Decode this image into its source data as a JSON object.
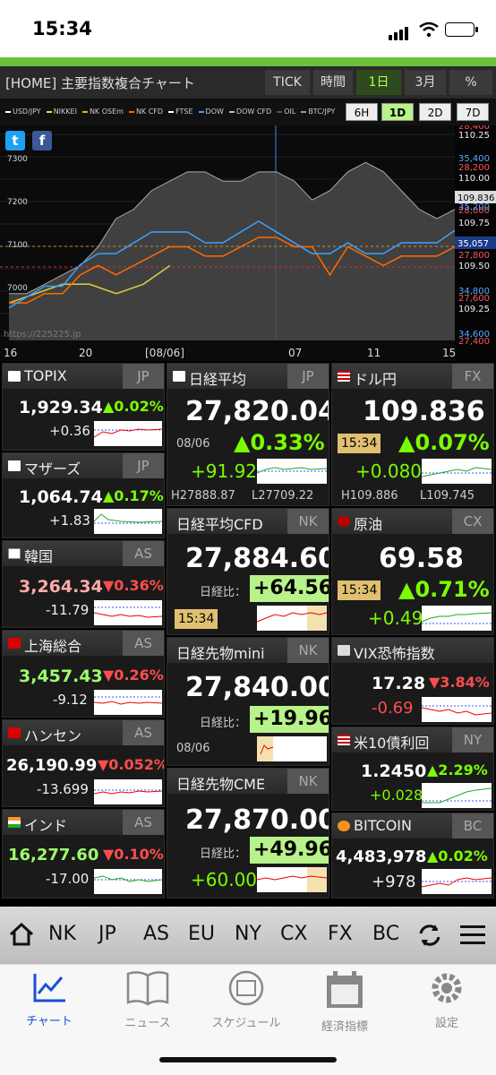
{
  "status": {
    "time": "15:34"
  },
  "header": {
    "title": "[HOME] 主要指数複合チャート",
    "period_tabs": [
      "TICK",
      "時間",
      "1日",
      "3月",
      "%"
    ],
    "active_period": "1日"
  },
  "legend": [
    {
      "label": "USD/JPY",
      "color": "#ffffff"
    },
    {
      "label": "NIKKEI",
      "color": "#f0e040"
    },
    {
      "label": "NK OSEm",
      "color": "#ffaa00"
    },
    {
      "label": "NK CFD",
      "color": "#ff6600"
    },
    {
      "label": "FTSE",
      "color": "#ffffff"
    },
    {
      "label": "DOW",
      "color": "#3aa0ff"
    },
    {
      "label": "DOW CFD",
      "color": "#88ccff"
    },
    {
      "label": "OIL",
      "color": "#555555"
    },
    {
      "label": "BTC/JPY",
      "color": "#999999"
    }
  ],
  "interval_tabs": [
    "6H",
    "1D",
    "2D",
    "7D"
  ],
  "active_interval": "1D",
  "chart_data": {
    "type": "line",
    "x_labels": [
      "16",
      "20",
      "[08/06]",
      "07",
      "11",
      "15"
    ],
    "left_axis": [
      "7300",
      "7200",
      "7100",
      "7000"
    ],
    "right_red": [
      "28,400",
      "28,200",
      "28,000",
      "27,800",
      "27,600",
      "27,400"
    ],
    "right_blue": [
      "35,400",
      "35,200",
      "34,800",
      "34,600"
    ],
    "right_white": [
      "110.25",
      "110.00",
      "109.75",
      "109.50",
      "109.25"
    ],
    "badges": {
      "usdjpy": "109.836",
      "dow": "35,057"
    },
    "watermark": "https://225225.jp",
    "series": [
      {
        "name": "USD/JPY",
        "values": [
          109.45,
          109.45,
          109.5,
          109.55,
          109.6,
          109.7,
          109.85,
          109.9,
          110.0,
          110.05,
          110.1,
          110.1,
          110.05,
          110.05,
          110.1,
          110.1,
          110.05,
          109.95,
          110.0,
          110.1,
          110.15,
          110.1,
          110.0,
          109.9,
          109.85,
          109.9
        ]
      },
      {
        "name": "NIKKEI",
        "values": [
          27550,
          27600,
          27650,
          27650,
          27600,
          27650,
          27750
        ]
      },
      {
        "name": "NK CFD",
        "values": [
          27550,
          27550,
          27600,
          27600,
          27700,
          27750,
          27700,
          27750,
          27800,
          27850,
          27850,
          27800,
          27800,
          27850,
          27900,
          27900,
          27850,
          27850,
          27700,
          27850,
          27800,
          27750,
          27800,
          27800,
          27800,
          27850
        ]
      },
      {
        "name": "DOW",
        "values": [
          34700,
          34750,
          34800,
          34800,
          34900,
          34950,
          34950,
          35000,
          35050,
          35050,
          35050,
          35000,
          35000,
          35050,
          35100,
          35050,
          35000,
          34950,
          34950,
          35000,
          34950,
          34950,
          35000,
          35000,
          35000,
          35057
        ]
      }
    ]
  },
  "social": {
    "twitter": "t",
    "facebook": "f"
  },
  "cards": {
    "topix": {
      "name": "TOPIX",
      "tag": "JP",
      "value": "1,929.34",
      "pct": "▲0.02%",
      "chg": "+0.36"
    },
    "mothers": {
      "name": "マザーズ",
      "tag": "JP",
      "value": "1,064.74",
      "pct": "▲0.17%",
      "chg": "+1.83"
    },
    "korea": {
      "name": "韓国",
      "tag": "AS",
      "value": "3,264.34",
      "pct": "▼0.36%",
      "chg": "-11.79"
    },
    "shanghai": {
      "name": "上海総合",
      "tag": "AS",
      "value": "3,457.43",
      "pct": "▼0.26%",
      "chg": "-9.12"
    },
    "hangseng": {
      "name": "ハンセン",
      "tag": "AS",
      "value": "26,190.99",
      "pct": "▼0.052%",
      "chg": "-13.699"
    },
    "india": {
      "name": "インド",
      "tag": "AS",
      "value": "16,277.60",
      "pct": "▼0.10%",
      "chg": "-17.00"
    },
    "nikkei": {
      "name": "日経平均",
      "tag": "JP",
      "value": "27,820.04",
      "date": "08/06",
      "pct": "▲0.33%",
      "chg": "+91.92",
      "high": "H27888.87",
      "low": "L27709.22"
    },
    "nkcfd": {
      "name": "日経平均CFD",
      "tag": "NK",
      "value": "27,884.60",
      "diff_label": "日経比：",
      "diff": "+64.56",
      "time": "15:34"
    },
    "nkmini": {
      "name": "日経先物mini",
      "tag": "NK",
      "value": "27,840.00",
      "diff_label": "日経比：",
      "diff": "+19.96",
      "date": "08/06"
    },
    "nkcme": {
      "name": "日経先物CME",
      "tag": "NK",
      "value": "27,870.00",
      "diff_label": "日経比：",
      "diff": "+49.96",
      "chg": "+60.00"
    },
    "usdjpy": {
      "name": "ドル円",
      "tag": "FX",
      "value": "109.836",
      "time": "15:34",
      "pct": "▲0.07%",
      "chg": "+0.080",
      "high": "H109.886",
      "low": "L109.745"
    },
    "oil": {
      "name": "原油",
      "tag": "CX",
      "value": "69.58",
      "time": "15:34",
      "pct": "▲0.71%",
      "chg": "+0.49"
    },
    "vix": {
      "name": "VIX恐怖指数",
      "value": "17.28",
      "pct": "▼3.84%",
      "chg": "-0.69"
    },
    "us10y": {
      "name": "米10債利回",
      "tag": "NY",
      "value": "1.2450",
      "pct": "▲2.29%",
      "chg": "+0.028"
    },
    "bitcoin": {
      "name": "BITCOIN",
      "tag": "BC",
      "value": "4,483,978",
      "pct": "▲0.02%",
      "chg": "+978"
    }
  },
  "region_nav": [
    "NK",
    "JP",
    "AS",
    "EU",
    "NY",
    "CX",
    "FX",
    "BC"
  ],
  "tabbar": [
    {
      "label": "チャート",
      "icon": "chart-icon"
    },
    {
      "label": "ニュース",
      "icon": "book-icon"
    },
    {
      "label": "スケジュール",
      "icon": "calendar-clock-icon"
    },
    {
      "label": "経済指標",
      "icon": "calendar-icon"
    },
    {
      "label": "設定",
      "icon": "gear-icon"
    }
  ],
  "colors": {
    "up": "#7CFC00",
    "down": "#ff4d4d",
    "accent": "#6cc23a",
    "tab_active": "#1a4fd6"
  }
}
